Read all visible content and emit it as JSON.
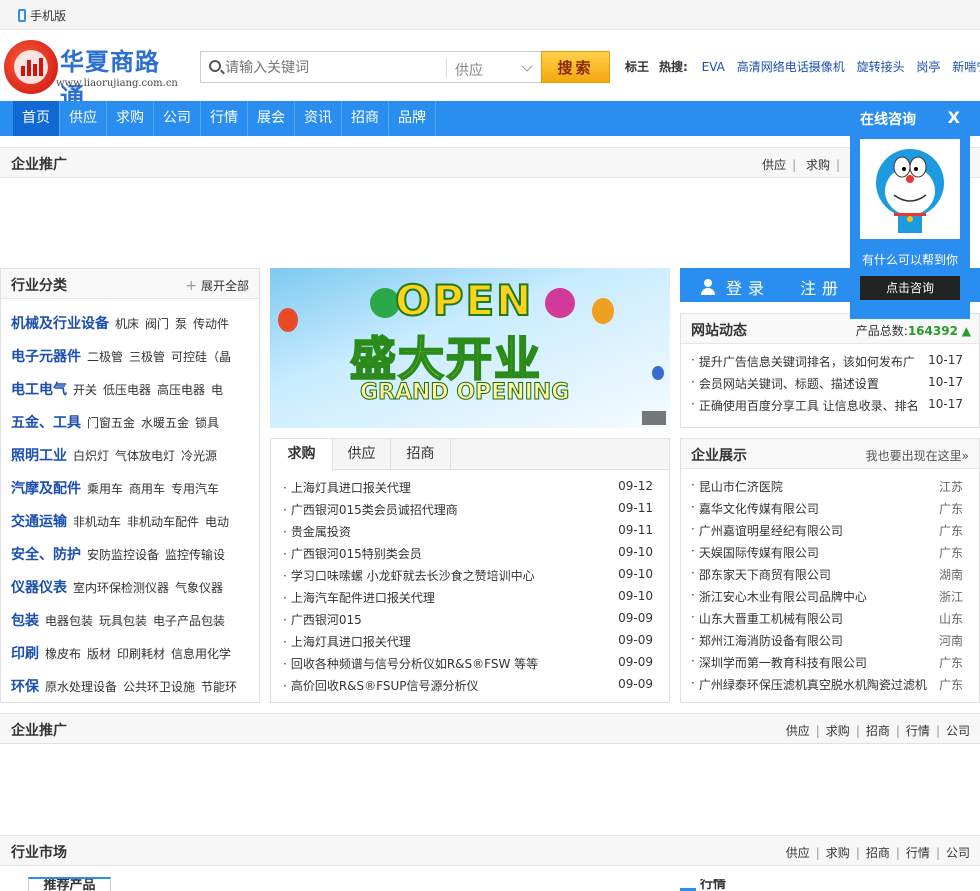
{
  "topbar": {
    "mobile_label": "手机版"
  },
  "logo": {
    "title": "华夏商路通",
    "url": "www.liaorujiang.com.cn"
  },
  "search": {
    "placeholder": "请输入关键词",
    "select": "供应",
    "button": "搜索"
  },
  "hot": {
    "label1": "标王",
    "label2": "热搜:",
    "words": [
      "EVA",
      "高清网络电话摄像机",
      "旋转接头",
      "岗亭",
      "新喘宁"
    ]
  },
  "nav": [
    "首页",
    "供应",
    "求购",
    "公司",
    "行情",
    "展会",
    "资讯",
    "招商",
    "品牌"
  ],
  "promo1": {
    "title": "企业推广",
    "links": [
      "供应",
      "求购"
    ]
  },
  "float": {
    "title": "在线咨询",
    "close": "X",
    "help": "有什么可以帮到你",
    "button": "点击咨询"
  },
  "categories": {
    "title": "行业分类",
    "expand": "展开全部",
    "rows": [
      {
        "name": "机械及行业设备",
        "items": [
          "机床",
          "阀门",
          "泵",
          "传动件"
        ]
      },
      {
        "name": "电子元器件",
        "items": [
          "二极管",
          "三极管",
          "可控硅（晶"
        ]
      },
      {
        "name": "电工电气",
        "items": [
          "开关",
          "低压电器",
          "高压电器",
          "电"
        ]
      },
      {
        "name": "五金、工具",
        "items": [
          "门窗五金",
          "水暖五金",
          "锁具"
        ]
      },
      {
        "name": "照明工业",
        "items": [
          "白炽灯",
          "气体放电灯",
          "冷光源"
        ]
      },
      {
        "name": "汽摩及配件",
        "items": [
          "乘用车",
          "商用车",
          "专用汽车"
        ]
      },
      {
        "name": "交通运输",
        "items": [
          "非机动车",
          "非机动车配件",
          "电动"
        ]
      },
      {
        "name": "安全、防护",
        "items": [
          "安防监控设备",
          "监控传输设"
        ]
      },
      {
        "name": "仪器仪表",
        "items": [
          "室内环保检测仪器",
          "气象仪器"
        ]
      },
      {
        "name": "包装",
        "items": [
          "电器包装",
          "玩具包装",
          "电子产品包装"
        ]
      },
      {
        "name": "印刷",
        "items": [
          "橡皮布",
          "版材",
          "印刷耗材",
          "信息用化学"
        ]
      },
      {
        "name": "环保",
        "items": [
          "原水处理设备",
          "公共环卫设施",
          "节能环"
        ]
      }
    ]
  },
  "banner": {
    "open": "OPEN",
    "cn": "盛大开业",
    "en": "GRAND OPENING"
  },
  "tabs": {
    "labels": [
      "求购",
      "供应",
      "招商"
    ],
    "items": [
      {
        "text": "上海灯具进口报关代理",
        "date": "09-12"
      },
      {
        "text": "广西银河015类会员诚招代理商",
        "date": "09-11"
      },
      {
        "text": "贵金属投资",
        "date": "09-11"
      },
      {
        "text": "广西银河015特别类会员",
        "date": "09-10"
      },
      {
        "text": "学习口味嗦螺 小龙虾就去长沙食之赞培训中心",
        "date": "09-10"
      },
      {
        "text": "上海汽车配件进口报关代理",
        "date": "09-10"
      },
      {
        "text": "广西银河015",
        "date": "09-09"
      },
      {
        "text": "上海灯具进口报关代理",
        "date": "09-09"
      },
      {
        "text": "回收各种频谱与信号分析仪如R&S®FSW 等等",
        "date": "09-09"
      },
      {
        "text": "高价回收R&S®FSUP信号源分析仪",
        "date": "09-09"
      }
    ]
  },
  "login": {
    "login": "登录",
    "register": "注册"
  },
  "news": {
    "title": "网站动态",
    "count_label": "产品总数:",
    "count": "164392",
    "items": [
      {
        "text": "提升广告信息关键词排名，该如何发布广",
        "date": "10-17"
      },
      {
        "text": "会员网站关键词、标题、描述设置",
        "date": "10-17"
      },
      {
        "text": "正确使用百度分享工具 让信息收录、排名",
        "date": "10-17"
      }
    ]
  },
  "companies": {
    "title": "企业展示",
    "more": "我也要出现在这里»",
    "items": [
      {
        "name": "昆山市仁济医院",
        "region": "江苏"
      },
      {
        "name": "嘉华文化传媒有限公司",
        "region": "广东"
      },
      {
        "name": "广州嘉谊明星经纪有限公司",
        "region": "广东"
      },
      {
        "name": "天娱国际传媒有限公司",
        "region": "广东"
      },
      {
        "name": "邵东家天下商贸有限公司",
        "region": "湖南"
      },
      {
        "name": "浙江安心木业有限公司品牌中心",
        "region": "浙江"
      },
      {
        "name": "山东大晋重工机械有限公司",
        "region": "山东"
      },
      {
        "name": "郑州江海消防设备有限公司",
        "region": "河南"
      },
      {
        "name": "深圳学而第一教育科技有限公司",
        "region": "广东"
      },
      {
        "name": "广州绿泰环保压滤机真空脱水机陶瓷过滤机",
        "region": "广东"
      }
    ]
  },
  "promo2": {
    "title": "企业推广",
    "links": [
      "供应",
      "求购",
      "招商",
      "行情",
      "公司"
    ]
  },
  "market": {
    "title": "行业市场",
    "links": [
      "供应",
      "求购",
      "招商",
      "行情",
      "公司"
    ]
  },
  "bottom_tabs": {
    "left": "推荐产品",
    "right": "行情"
  },
  "colors": {
    "brand_blue": "#2a8ef0",
    "accent_orange": "#f3a810",
    "link_blue": "#1b4fb0",
    "count_green": "#2a9a2a"
  }
}
